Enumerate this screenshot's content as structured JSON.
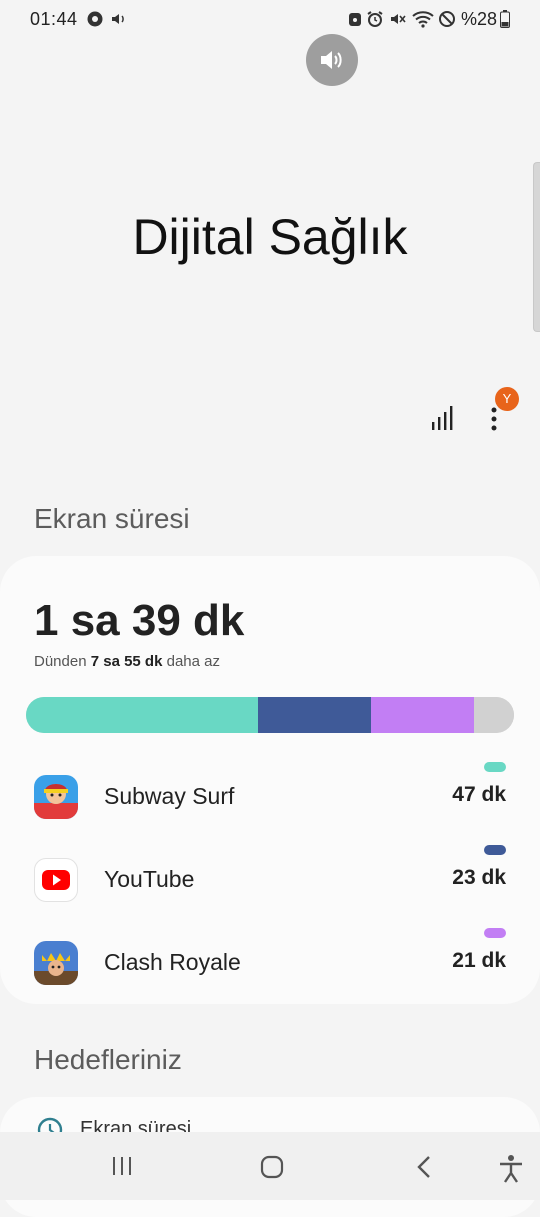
{
  "status_bar": {
    "time": "01:44",
    "battery": "%28"
  },
  "header": {
    "title": "Dijital Sağlık",
    "badge": "Y"
  },
  "screen_time": {
    "section_label": "Ekran süresi",
    "total": "1 sa 39 dk",
    "compare_prefix": "Dünden ",
    "compare_value": "7 sa 55 dk",
    "compare_suffix": " daha az",
    "bar_segments": [
      {
        "app": "Subway Surf",
        "fraction": 0.475,
        "color": "#69d8c4"
      },
      {
        "app": "YouTube",
        "fraction": 0.232,
        "color": "#3f5a98"
      },
      {
        "app": "Clash Royale",
        "fraction": 0.212,
        "color": "#c27ef4"
      },
      {
        "app": "other",
        "fraction": 0.081,
        "color": "#d1d1d1"
      }
    ],
    "apps": [
      {
        "name": "Subway Surf",
        "duration": "47 dk",
        "color": "#69d8c4",
        "icon": "subway-surf-icon"
      },
      {
        "name": "YouTube",
        "duration": "23 dk",
        "color": "#3f5a98",
        "icon": "youtube-icon"
      },
      {
        "name": "Clash Royale",
        "duration": "21 dk",
        "color": "#c27ef4",
        "icon": "clash-royale-icon"
      }
    ]
  },
  "goals": {
    "section_label": "Hedefleriniz",
    "first_item": "Ekran süresi"
  }
}
